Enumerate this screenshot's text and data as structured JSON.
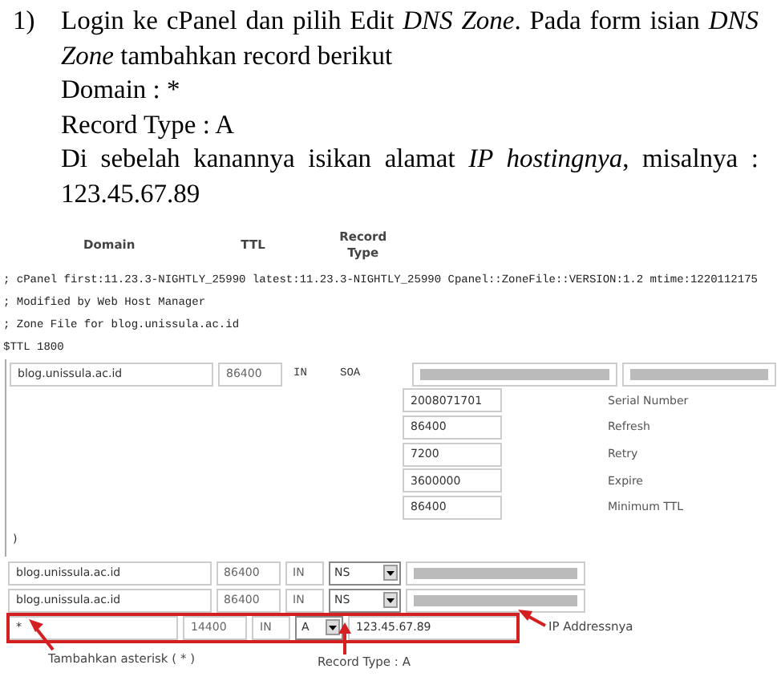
{
  "instruction": {
    "number": "1)",
    "lines": [
      "Login ke cPanel dan pilih Edit *DNS Zone*. Pada form isian *DNS Zone* tambahkan record berikut",
      "Domain : *",
      "Record Type : A",
      "Di sebelah kanannya isikan alamat *IP hostingnya*, misalnya : 123.45.67.89"
    ]
  },
  "zone_editor": {
    "columns": [
      "Domain",
      "TTL",
      "Record Type"
    ],
    "comments": [
      "; cPanel first:11.23.3-NIGHTLY_25990 latest:11.23.3-NIGHTLY_25990 Cpanel::ZoneFile::VERSION:1.2 mtime:1220112175",
      "; Modified by Web Host Manager",
      "; Zone File for blog.unissula.ac.id",
      "$TTL 1800"
    ],
    "soa": {
      "domain": "blog.unissula.ac.id",
      "ttl": "86400",
      "class": "IN",
      "type": "SOA",
      "fields": [
        {
          "value": "2008071701",
          "label": "Serial Number"
        },
        {
          "value": "86400",
          "label": "Refresh"
        },
        {
          "value": "7200",
          "label": "Retry"
        },
        {
          "value": "3600000",
          "label": "Expire"
        },
        {
          "value": "86400",
          "label": "Minimum TTL"
        }
      ],
      "closing": ")"
    },
    "records": [
      {
        "domain": "blog.unissula.ac.id",
        "ttl": "86400",
        "class": "IN",
        "type": "NS",
        "kind": "redacted",
        "highlighted": false
      },
      {
        "domain": "blog.unissula.ac.id",
        "ttl": "86400",
        "class": "IN",
        "type": "NS",
        "kind": "redacted",
        "highlighted": false
      },
      {
        "domain": "*",
        "ttl": "14400",
        "class": "IN",
        "type": "A",
        "kind": "value",
        "value": "123.45.67.89",
        "highlighted": true
      }
    ],
    "annotations": [
      "Tambahkan asterisk ( * )",
      "Record Type : A",
      "IP Addressnya"
    ]
  }
}
